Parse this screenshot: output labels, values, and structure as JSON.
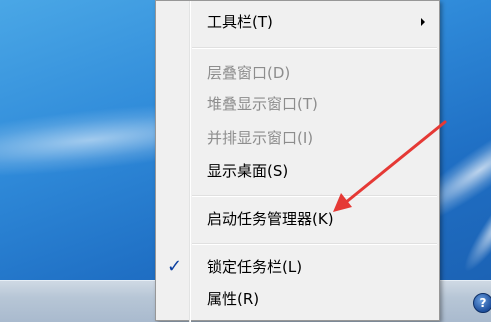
{
  "context_menu": {
    "items": [
      {
        "label": "工具栏(T)",
        "enabled": true,
        "has_submenu": true
      },
      {
        "label": "层叠窗口(D)",
        "enabled": false
      },
      {
        "label": "堆叠显示窗口(T)",
        "enabled": false
      },
      {
        "label": "并排显示窗口(I)",
        "enabled": false
      },
      {
        "label": "显示桌面(S)",
        "enabled": true
      },
      {
        "label": "启动任务管理器(K)",
        "enabled": true
      },
      {
        "label": "锁定任务栏(L)",
        "enabled": true,
        "checked": true
      },
      {
        "label": "属性(R)",
        "enabled": true
      }
    ],
    "check_glyph": "✓"
  },
  "taskbar": {
    "help_icon_glyph": "?"
  },
  "colors": {
    "menu_background": "#f0f0f0",
    "disabled_text": "#8d8d8d",
    "annotation_arrow": "#e53935",
    "desktop_blue": "#2f8ad9"
  }
}
